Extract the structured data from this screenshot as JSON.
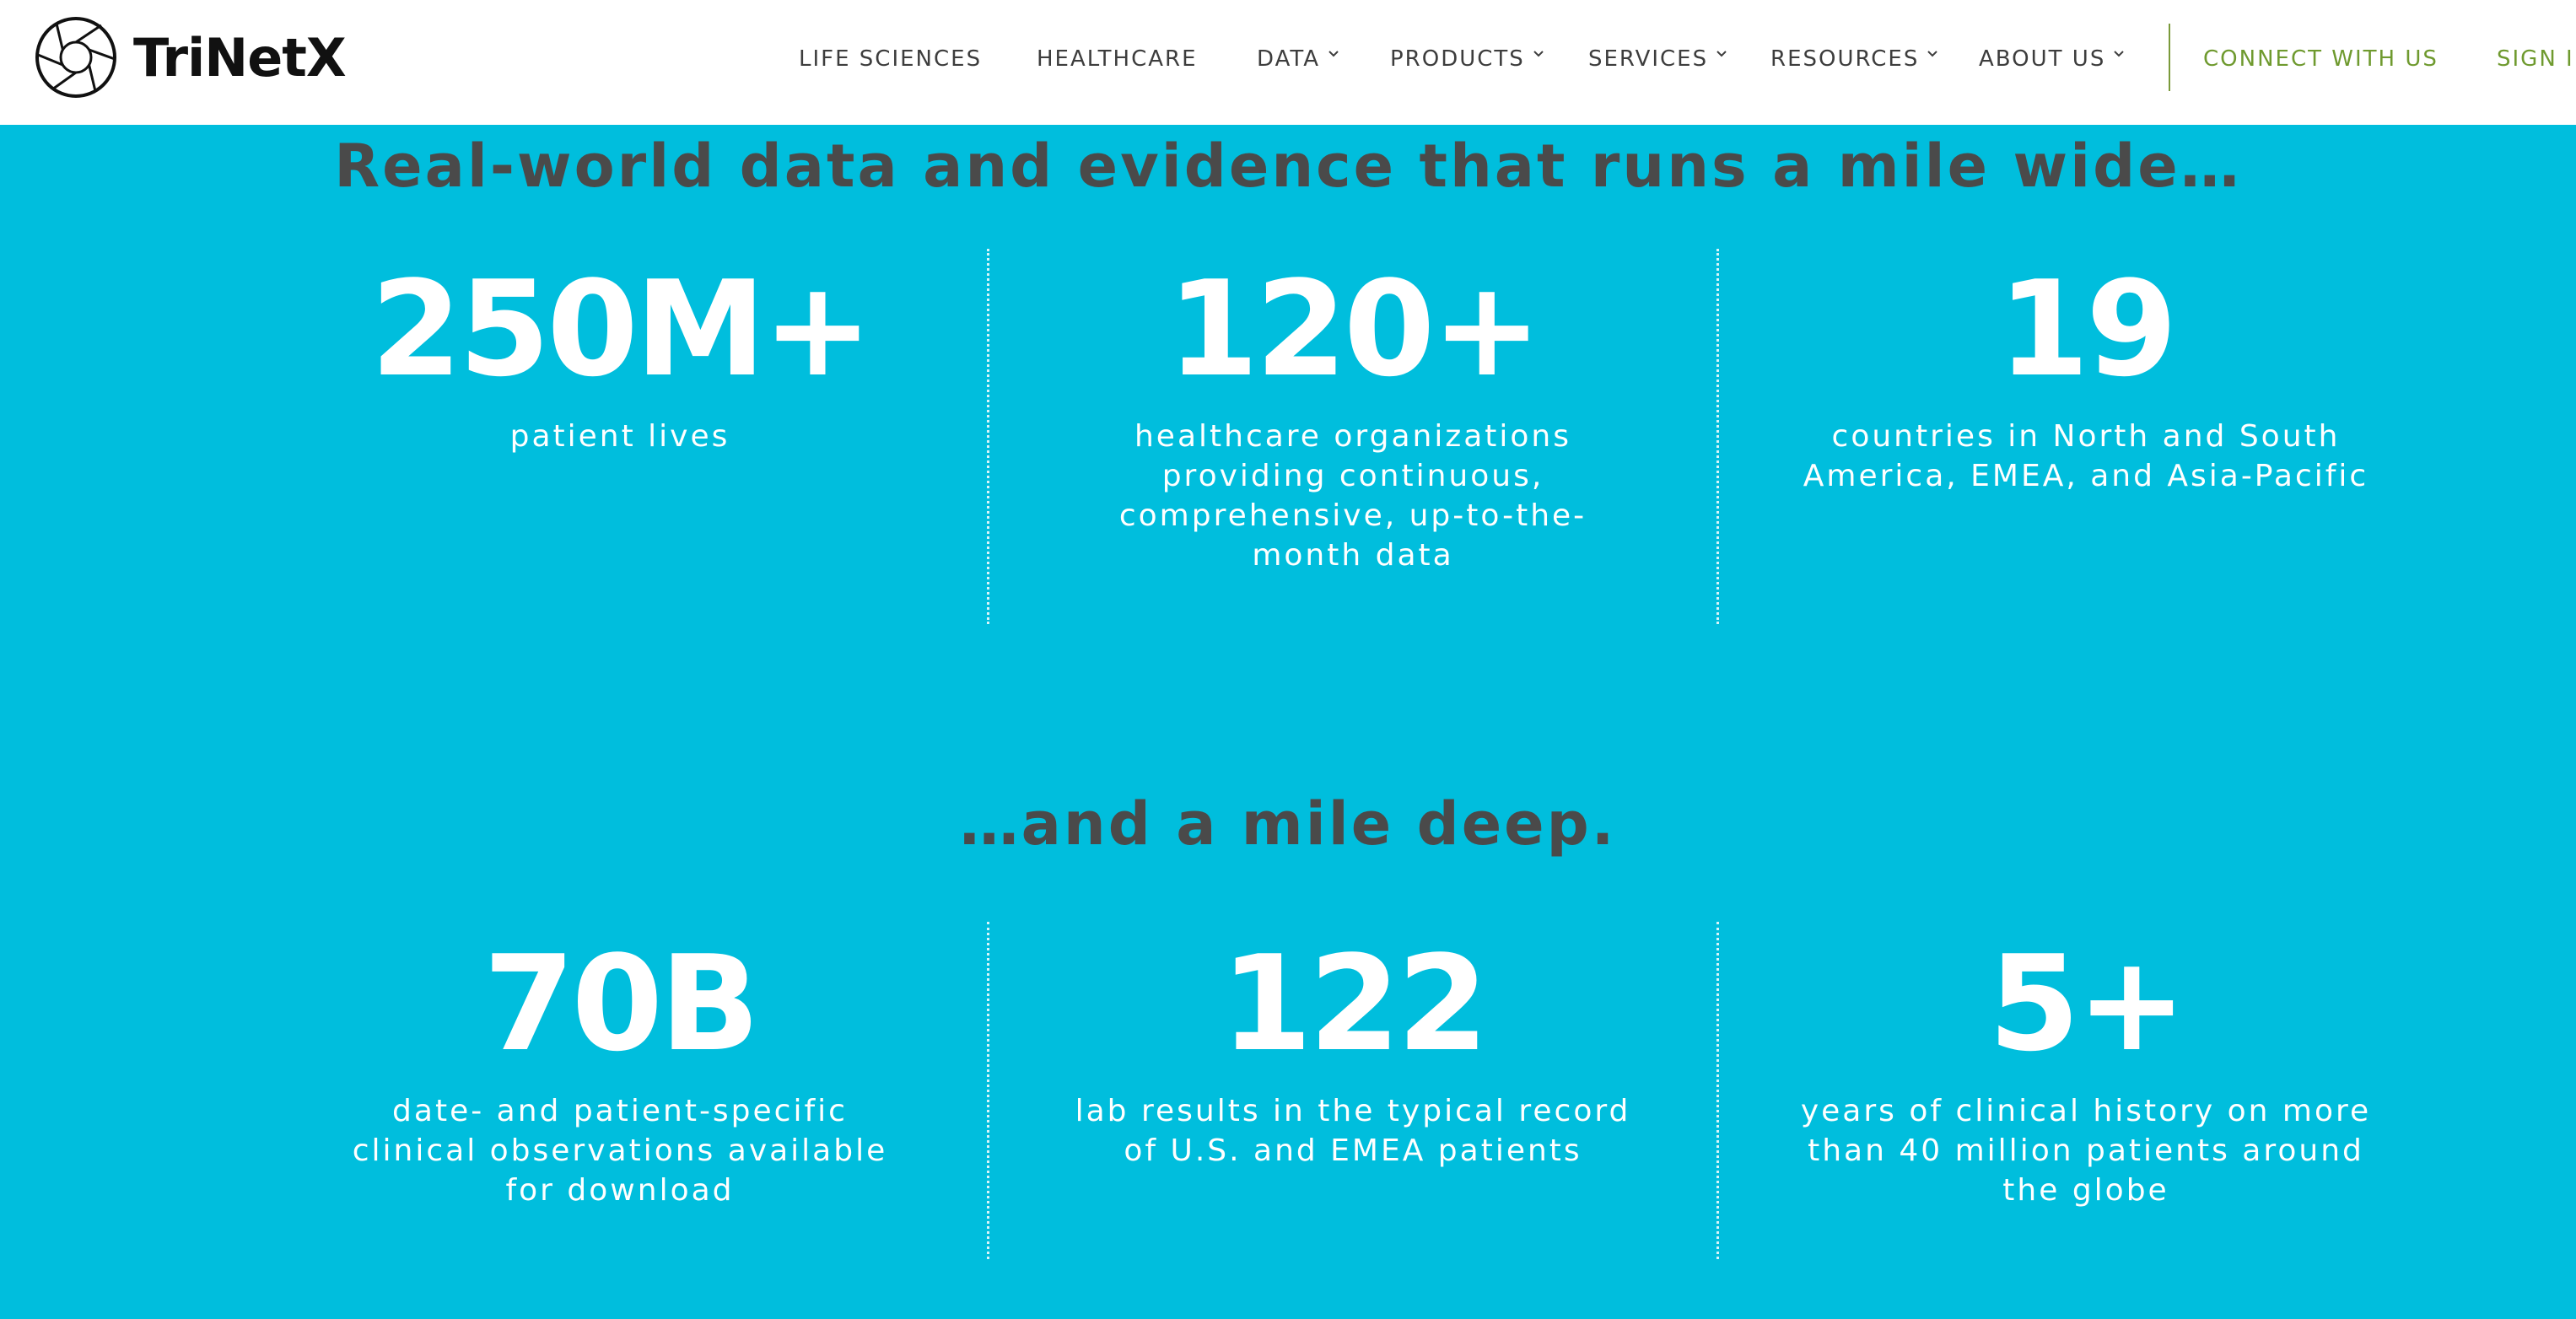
{
  "header": {
    "logo_text": "TriNetX",
    "nav": [
      {
        "label": "LIFE SCIENCES",
        "has_dropdown": false
      },
      {
        "label": "HEALTHCARE",
        "has_dropdown": false
      },
      {
        "label": "DATA",
        "has_dropdown": true
      },
      {
        "label": "PRODUCTS",
        "has_dropdown": true
      },
      {
        "label": "SERVICES",
        "has_dropdown": true
      },
      {
        "label": "RESOURCES",
        "has_dropdown": true
      },
      {
        "label": "ABOUT US",
        "has_dropdown": true
      }
    ],
    "connect_label": "CONNECT WITH US",
    "signin_label": "SIGN IN"
  },
  "colors": {
    "background": "#00bedd",
    "header_bg": "#ffffff",
    "heading_text": "#4a4a4a",
    "stat_text": "#ffffff",
    "cta_green": "#6f9a2f"
  },
  "wide": {
    "title": "Real-world data and evidence that runs a mile wide…",
    "stats": [
      {
        "number": "250M+",
        "description": "patient lives"
      },
      {
        "number": "120+",
        "description": "healthcare organizations providing continuous, comprehensive, up-to-the-month data"
      },
      {
        "number": "19",
        "description": "countries in North and South America, EMEA, and Asia-Pacific"
      }
    ]
  },
  "deep": {
    "title": "…and a mile deep.",
    "stats": [
      {
        "number": "70B",
        "description": "date- and patient-specific clinical observations available for download"
      },
      {
        "number": "122",
        "description": "lab results in the typical record of U.S. and EMEA patients"
      },
      {
        "number": "5+",
        "description": "years of clinical history on more than 40 million patients around the globe"
      }
    ]
  }
}
